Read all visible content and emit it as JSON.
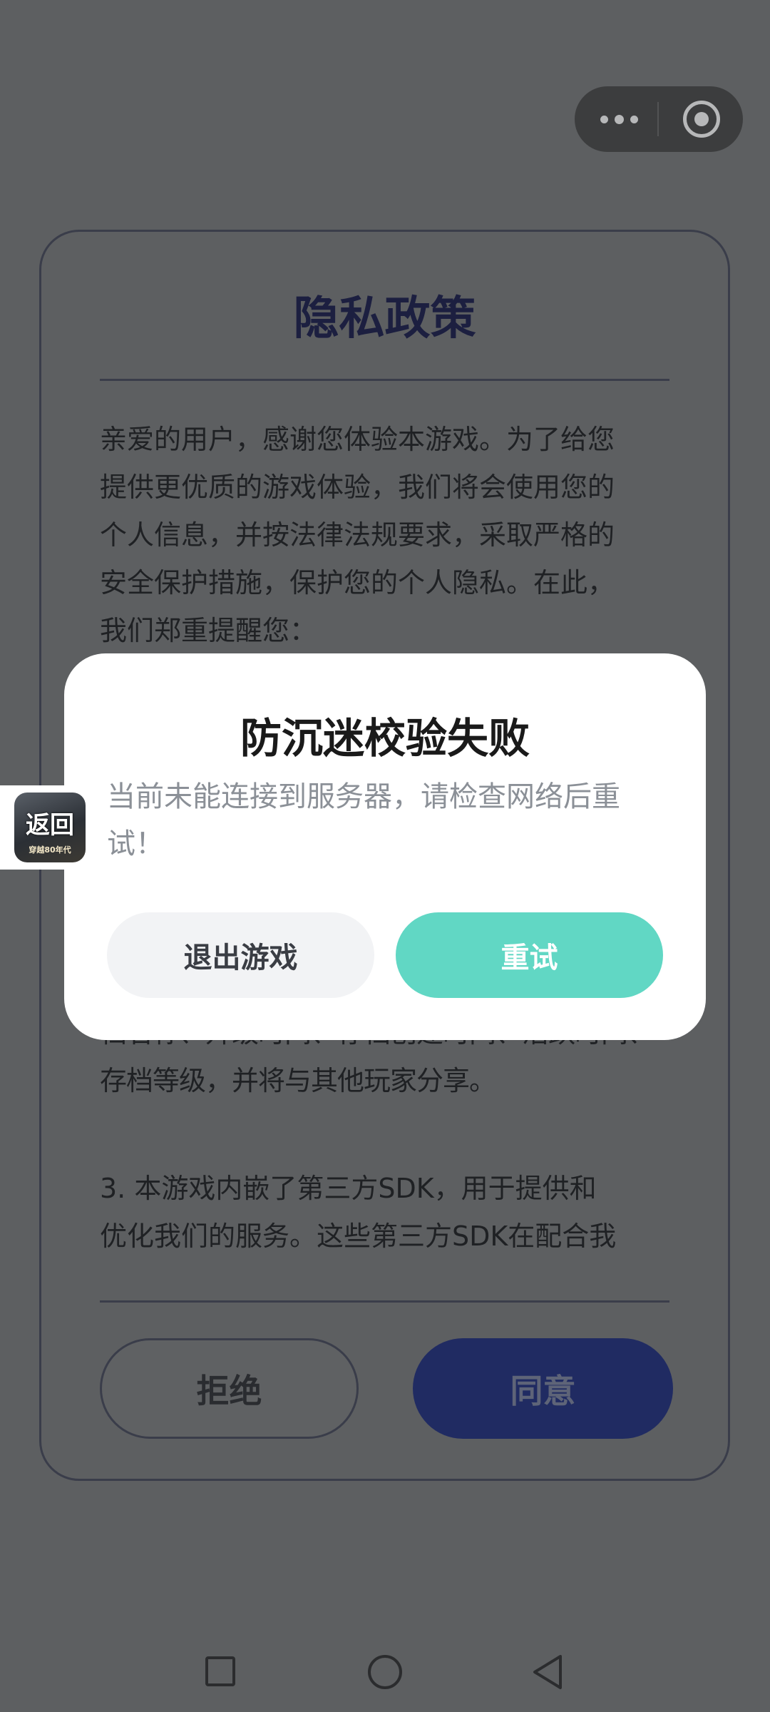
{
  "capsule_menu": {
    "more_icon": "more-dots-icon",
    "close_icon": "target-icon"
  },
  "policy": {
    "title": "隐私政策",
    "intro": "亲爱的用户，感谢您体验本游戏。为了给您\n提供更优质的游戏体验，我们将会使用您的\n个人信息，并按法律法规要求，采取严格的\n安全保护措施，保护您的个人隐私。在此，\n我们郑重提醒您：",
    "partial_line": "档名称、升级时间、存档创建时间、活跃时间、\n存档等级，并将与其他玩家分享。",
    "item3": "3. 本游戏内嵌了第三方SDK，用于提供和\n优化我们的服务。这些第三方SDK在配合我",
    "reject_label": "拒绝",
    "agree_label": "同意"
  },
  "dialog": {
    "title": "防沉迷校验失败",
    "message": "当前未能连接到服务器，请检查网络后重试！",
    "exit_label": "退出游戏",
    "retry_label": "重试"
  },
  "back_float": {
    "label": "返回",
    "sublabel": "穿越80年代"
  },
  "nav": {
    "recent_icon": "square-icon",
    "home_icon": "circle-icon",
    "back_icon": "triangle-back-icon"
  },
  "colors": {
    "accent_teal": "#61d7c4",
    "agree_navy": "#202b62",
    "overlay": "#5d5f61"
  }
}
